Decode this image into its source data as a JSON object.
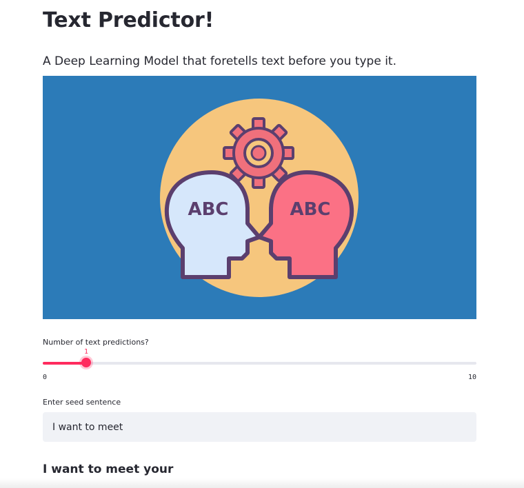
{
  "app": {
    "title": "Text Predictor!",
    "subtitle": "A Deep Learning Model that foretells text before you type it."
  },
  "hero_image": {
    "left_head_text": "ABC",
    "right_head_text": "ABC",
    "icons": [
      "head-profile-icon",
      "gear-icon"
    ],
    "colors": {
      "background": "#2c7bb8",
      "circle": "#f6c67d",
      "gear": "#f0707c",
      "left_head": "#d6e7fb",
      "right_head": "#fb7185",
      "outline": "#5b3f6e"
    }
  },
  "slider": {
    "label": "Number of text predictions?",
    "min_label": "0",
    "max_label": "10",
    "min": 0,
    "max": 10,
    "value": 1,
    "value_label": "1",
    "accent_color": "#ff2b5e"
  },
  "seed_input": {
    "label": "Enter seed sentence",
    "value": "I want to meet"
  },
  "prediction": {
    "text": "I want to meet your"
  }
}
